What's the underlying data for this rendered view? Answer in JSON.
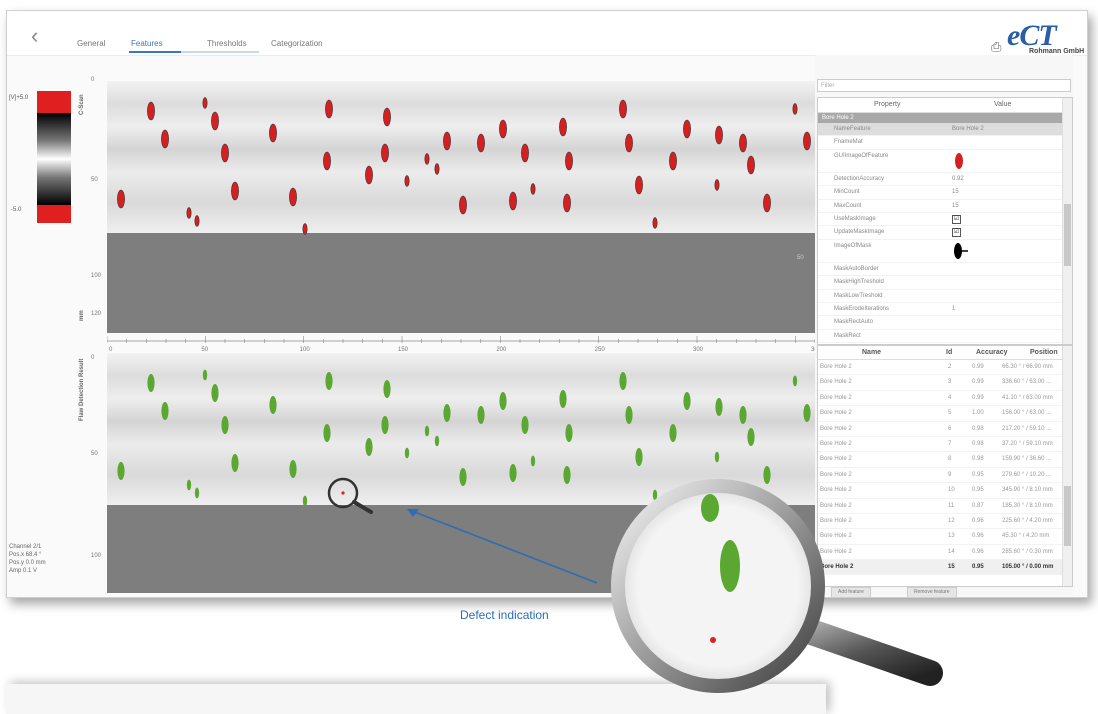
{
  "nav": {
    "back_label": "‹",
    "tabs": [
      {
        "label": "General",
        "active": false
      },
      {
        "label": "Features",
        "active": true
      },
      {
        "label": "Thresholds",
        "active": false
      },
      {
        "label": "Categorization",
        "active": false
      }
    ]
  },
  "logo": {
    "mark": "eCT",
    "company": "Rohmann GmbH"
  },
  "color_scale": {
    "top_label": "[V]+5.0",
    "bottom_label": "-5.0",
    "accent": "#e02020"
  },
  "cscan": {
    "title": "C-Scan",
    "y_ticks": [
      "0",
      "50",
      "100",
      "120"
    ],
    "unit": "mm",
    "side_tick": "50"
  },
  "flaw": {
    "title": "Flaw Detection Result",
    "y_ticks": [
      "0",
      "50",
      "100"
    ],
    "side_tick": "25"
  },
  "x_axis": {
    "ticks": [
      "0",
      "50",
      "100",
      "150",
      "200",
      "250",
      "300",
      "360"
    ]
  },
  "status": {
    "lines": [
      "Channel 2/1",
      "Pos.x 68.4 °",
      "Pos.y 0.0 mm",
      "Amp 0.1 V"
    ]
  },
  "properties": {
    "filter_placeholder": "Filter",
    "header_property": "Property",
    "header_value": "Value",
    "group": "Bore Hole 2",
    "rows": [
      {
        "key": "NameFeature",
        "value": "Bore Hole 2"
      },
      {
        "key": "FnameMat",
        "value": ""
      },
      {
        "key": "GUIImageOfFeature",
        "value": ""
      },
      {
        "key": "DetectionAccuracy",
        "value": "0.92"
      },
      {
        "key": "MinCount",
        "value": "15"
      },
      {
        "key": "MaxCount",
        "value": "15"
      },
      {
        "key": "UseMaskImage",
        "value": "☑"
      },
      {
        "key": "UpdateMaskImage",
        "value": "☑"
      },
      {
        "key": "ImageOfMask",
        "value": ""
      },
      {
        "key": "MaskAutoBorder",
        "value": ""
      },
      {
        "key": "MaskHighTreshold",
        "value": ""
      },
      {
        "key": "MaskLowTreshold",
        "value": ""
      },
      {
        "key": "MaskErodeIterations",
        "value": "1"
      },
      {
        "key": "MaskRectAuto",
        "value": ""
      },
      {
        "key": "MaskRect",
        "value": ""
      }
    ]
  },
  "features": {
    "headers": {
      "name": "Name",
      "id": "Id",
      "accuracy": "Accuracy",
      "position": "Position"
    },
    "rows": [
      {
        "name": "Bore Hole 2",
        "id": "2",
        "acc": "0.99",
        "pos": "66.30 ° / 66.90 mm"
      },
      {
        "name": "Bore Hole 2",
        "id": "3",
        "acc": "0.99",
        "pos": "336.60 ° / 63.00 ..."
      },
      {
        "name": "Bore Hole 2",
        "id": "4",
        "acc": "0.99",
        "pos": "41.10 ° / 63.00 mm"
      },
      {
        "name": "Bore Hole 2",
        "id": "5",
        "acc": "1.00",
        "pos": "156.00 ° / 63.00 ..."
      },
      {
        "name": "Bore Hole 2",
        "id": "6",
        "acc": "0.98",
        "pos": "217.20 ° / 59.10 ..."
      },
      {
        "name": "Bore Hole 2",
        "id": "7",
        "acc": "0.98",
        "pos": "37.20 ° / 59.10 mm"
      },
      {
        "name": "Bore Hole 2",
        "id": "8",
        "acc": "0.98",
        "pos": "159.90 ° / 36.60 ..."
      },
      {
        "name": "Bore Hole 2",
        "id": "9",
        "acc": "0.95",
        "pos": "279.60 ° / 10.20 ..."
      },
      {
        "name": "Bore Hole 2",
        "id": "10",
        "acc": "0.95",
        "pos": "345.90 ° / 8.10 mm"
      },
      {
        "name": "Bore Hole 2",
        "id": "11",
        "acc": "0.87",
        "pos": "185.30 ° / 8.10 mm"
      },
      {
        "name": "Bore Hole 2",
        "id": "12",
        "acc": "0.96",
        "pos": "225.60 ° / 4.20 mm"
      },
      {
        "name": "Bore Hole 2",
        "id": "13",
        "acc": "0.96",
        "pos": "45.30 ° / 4.20 mm"
      },
      {
        "name": "Bore Hole 2",
        "id": "14",
        "acc": "0.96",
        "pos": "285.60 ° / 0.30 mm"
      },
      {
        "name": "Bore Hole 2",
        "id": "15",
        "acc": "0.95",
        "pos": "105.00 ° / 0.00 mm"
      }
    ],
    "add_label": "Add feature",
    "remove_label": "Remove feature"
  },
  "annotation": {
    "callout": "Defect indication"
  }
}
